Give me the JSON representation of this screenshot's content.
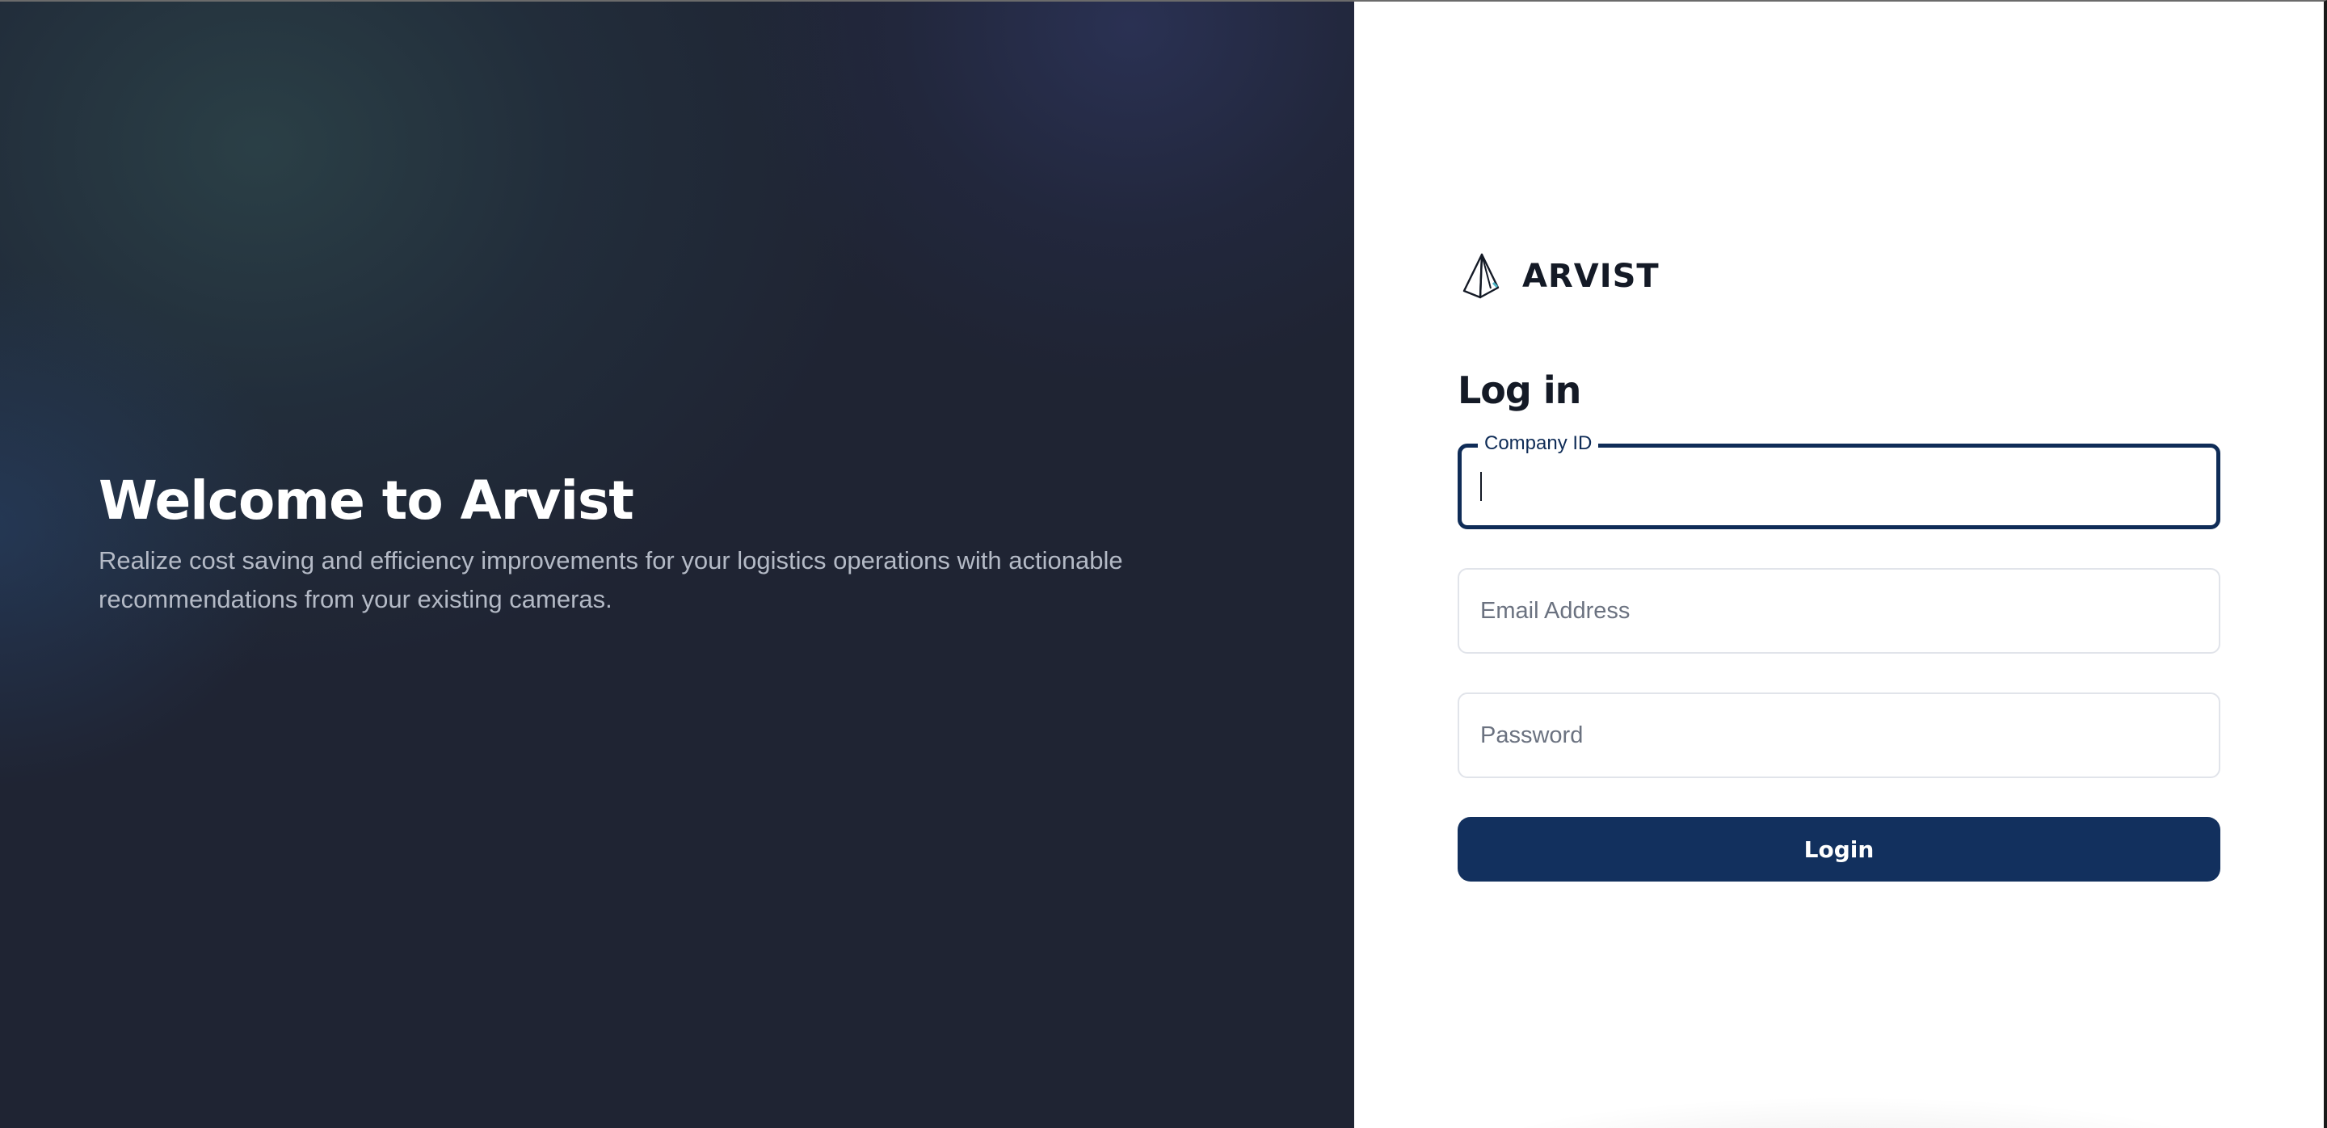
{
  "hero": {
    "title": "Welcome to Arvist",
    "subtitle": "Realize cost saving and efficiency improvements for your logistics operations with actionable recommendations from your existing cameras."
  },
  "brand": {
    "name": "ARVIST",
    "logo_icon": "pyramid-logo-icon"
  },
  "login": {
    "title": "Log in",
    "fields": {
      "company_id": {
        "label": "Company ID",
        "value": "",
        "placeholder": ""
      },
      "email": {
        "placeholder": "Email Address",
        "value": ""
      },
      "password": {
        "placeholder": "Password",
        "value": ""
      }
    },
    "button_label": "Login"
  },
  "colors": {
    "hero_background": "#1f2433",
    "primary": "#12305e",
    "focus_border": "#0f2c57",
    "text_dark": "#141a26",
    "subtitle_text": "#b4bac6"
  }
}
